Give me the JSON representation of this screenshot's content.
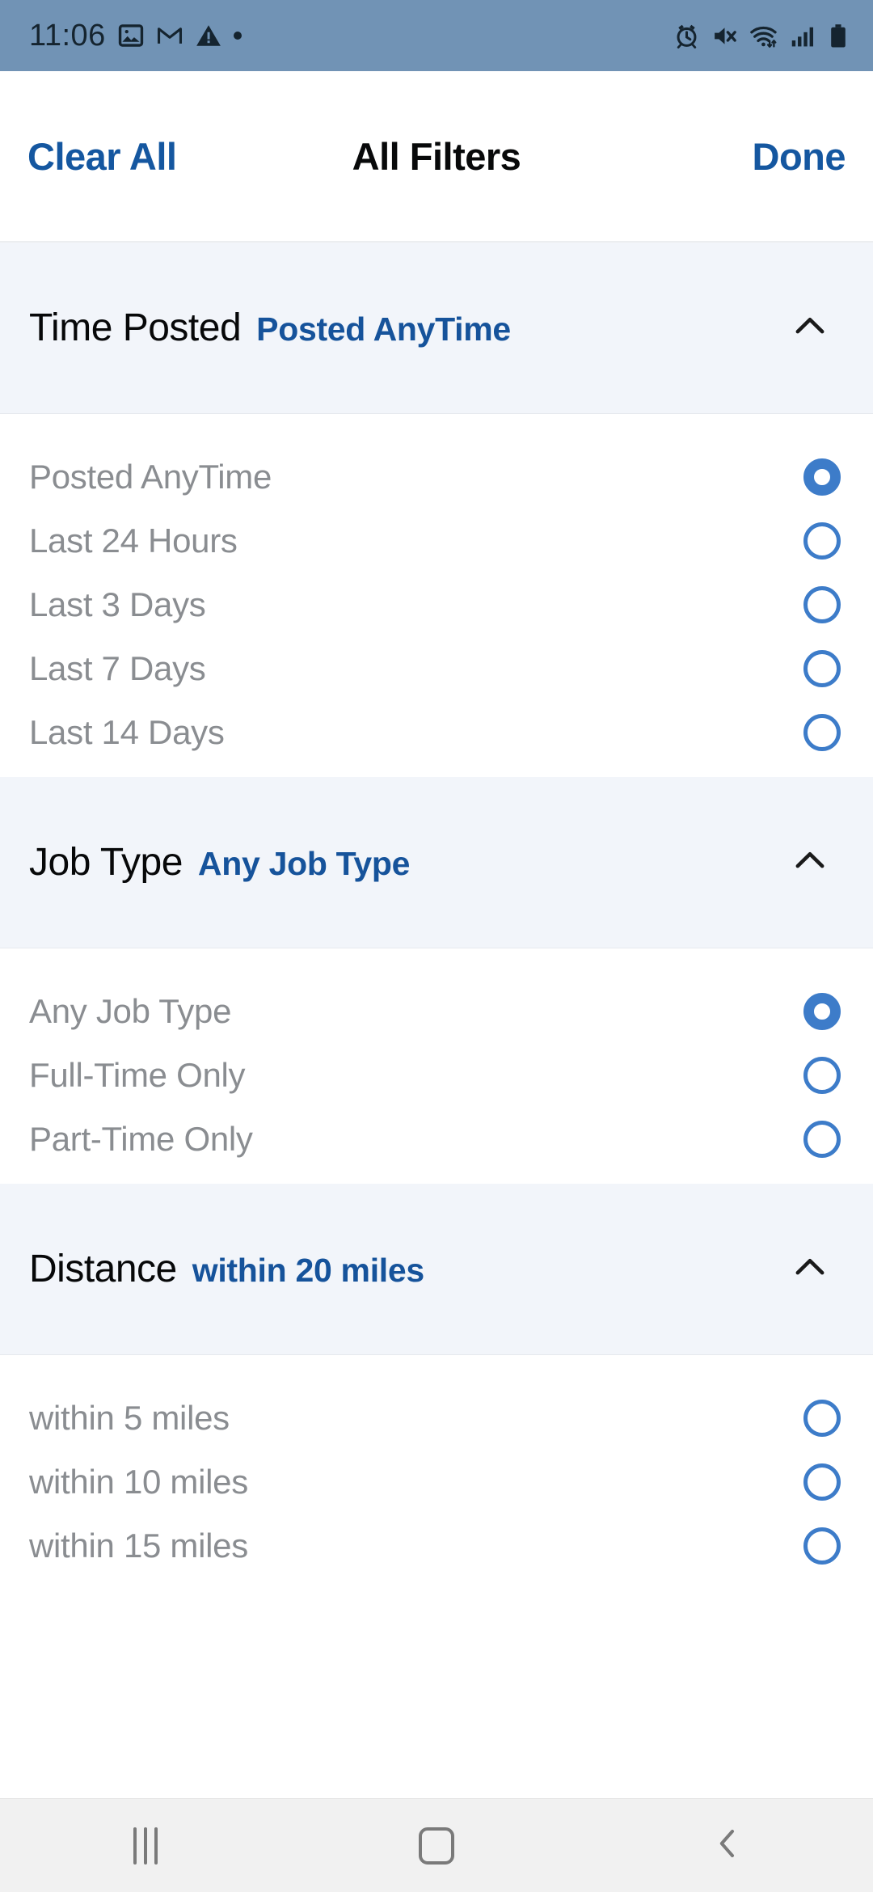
{
  "status_bar": {
    "time": "11:06",
    "left_icons": [
      "photos-icon",
      "gmail-icon",
      "warning-icon",
      "dot-icon"
    ],
    "right_icons": [
      "alarm-icon",
      "mute-icon",
      "wifi-icon",
      "signal-icon",
      "battery-icon"
    ],
    "background_color": "#7193b5"
  },
  "header": {
    "clear_all_label": "Clear All",
    "title": "All Filters",
    "done_label": "Done",
    "accent_color": "#1557a0"
  },
  "sections": [
    {
      "title": "Time Posted",
      "value": "Posted AnyTime",
      "collapse_icon": "chevron-up-icon",
      "expanded": true,
      "options": [
        {
          "label": "Posted AnyTime",
          "selected": true
        },
        {
          "label": "Last 24 Hours",
          "selected": false
        },
        {
          "label": "Last 3 Days",
          "selected": false
        },
        {
          "label": "Last 7 Days",
          "selected": false
        },
        {
          "label": "Last 14 Days",
          "selected": false
        }
      ]
    },
    {
      "title": "Job Type",
      "value": "Any Job Type",
      "collapse_icon": "chevron-up-icon",
      "expanded": true,
      "options": [
        {
          "label": "Any Job Type",
          "selected": true
        },
        {
          "label": "Full-Time Only",
          "selected": false
        },
        {
          "label": "Part-Time Only",
          "selected": false
        }
      ]
    },
    {
      "title": "Distance",
      "value": "within 20 miles",
      "collapse_icon": "chevron-up-icon",
      "expanded": true,
      "options": [
        {
          "label": "within 5 miles",
          "selected": false
        },
        {
          "label": "within 10 miles",
          "selected": false
        },
        {
          "label": "within 15 miles",
          "selected": false
        }
      ]
    }
  ],
  "nav_bar": {
    "recents_label": "recents-icon",
    "home_label": "home-icon",
    "back_label": "back-icon"
  },
  "colors": {
    "accent_blue": "#1557a0",
    "radio_blue": "#3d7cc9",
    "section_band": "#f2f5fa",
    "label_gray": "#8a8d91"
  }
}
